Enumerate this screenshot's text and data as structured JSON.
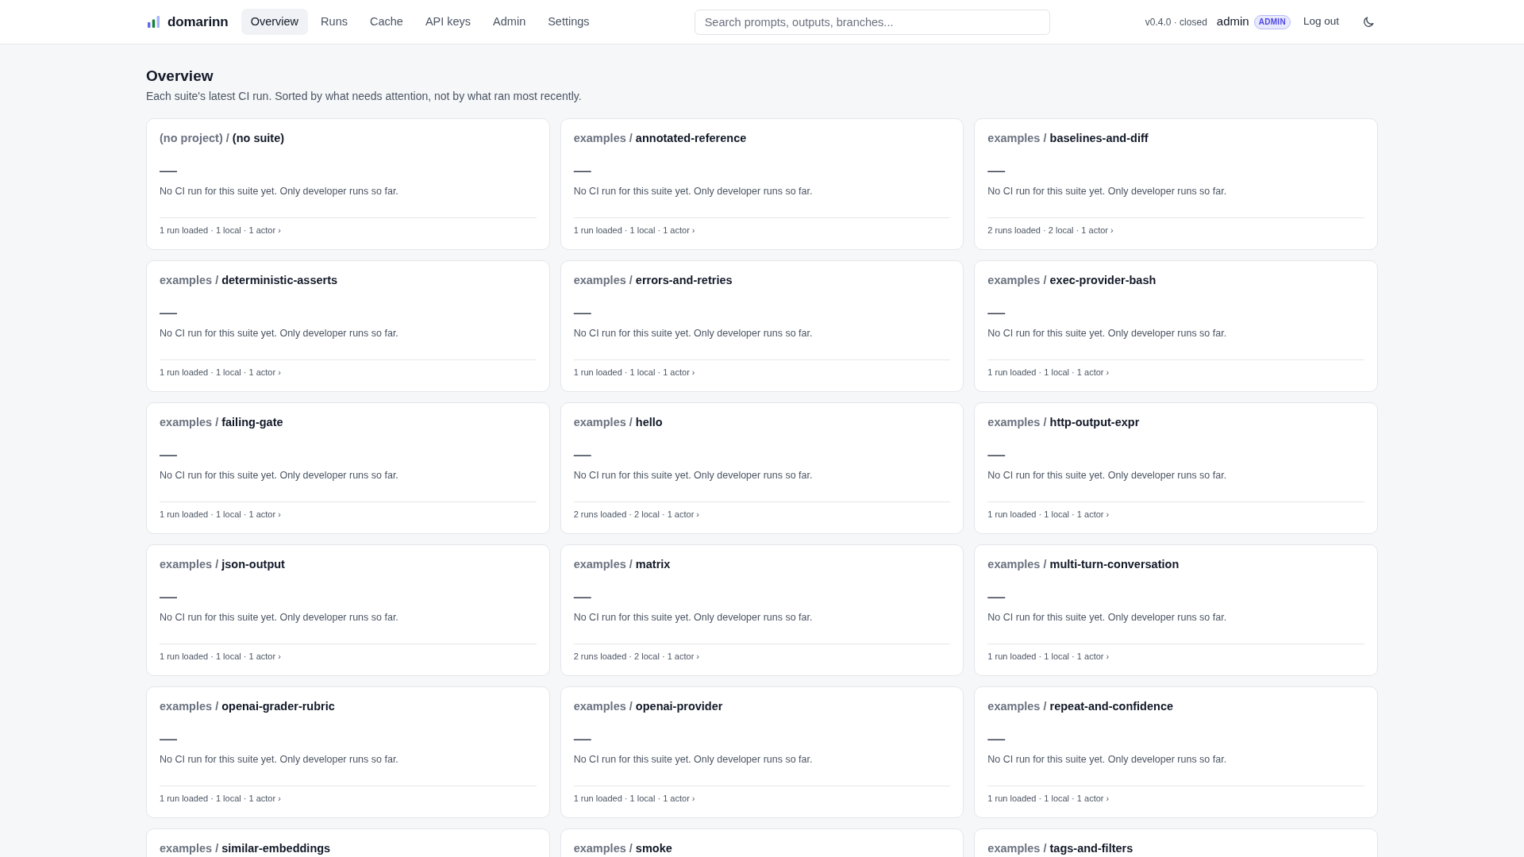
{
  "header": {
    "brand": "domarinn",
    "nav": [
      {
        "label": "Overview",
        "selected": true
      },
      {
        "label": "Runs",
        "selected": false
      },
      {
        "label": "Cache",
        "selected": false
      },
      {
        "label": "API keys",
        "selected": false
      },
      {
        "label": "Admin",
        "selected": false
      },
      {
        "label": "Settings",
        "selected": false
      }
    ],
    "search": {
      "placeholder": "Search prompts, outputs, branches..."
    },
    "version": "v0.4.0 · closed",
    "user": "admin",
    "role_badge": "ADMIN",
    "logout": "Log out"
  },
  "page": {
    "title": "Overview",
    "subtitle": "Each suite's latest CI run. Sorted by what needs attention, not by what ran most recently."
  },
  "suites": [
    {
      "project_path": "(no project) /",
      "suite": "(no suite)",
      "status": "—",
      "note": "No CI run for this suite yet. Only developer runs so far.",
      "summary": "1 run loaded · 1 local · 1 actor ›"
    },
    {
      "project_path": "examples /",
      "suite": "annotated-reference",
      "status": "—",
      "note": "No CI run for this suite yet. Only developer runs so far.",
      "summary": "1 run loaded · 1 local · 1 actor ›"
    },
    {
      "project_path": "examples /",
      "suite": "baselines-and-diff",
      "status": "—",
      "note": "No CI run for this suite yet. Only developer runs so far.",
      "summary": "2 runs loaded · 2 local · 1 actor ›"
    },
    {
      "project_path": "examples /",
      "suite": "deterministic-asserts",
      "status": "—",
      "note": "No CI run for this suite yet. Only developer runs so far.",
      "summary": "1 run loaded · 1 local · 1 actor ›"
    },
    {
      "project_path": "examples /",
      "suite": "errors-and-retries",
      "status": "—",
      "note": "No CI run for this suite yet. Only developer runs so far.",
      "summary": "1 run loaded · 1 local · 1 actor ›"
    },
    {
      "project_path": "examples /",
      "suite": "exec-provider-bash",
      "status": "—",
      "note": "No CI run for this suite yet. Only developer runs so far.",
      "summary": "1 run loaded · 1 local · 1 actor ›"
    },
    {
      "project_path": "examples /",
      "suite": "failing-gate",
      "status": "—",
      "note": "No CI run for this suite yet. Only developer runs so far.",
      "summary": "1 run loaded · 1 local · 1 actor ›"
    },
    {
      "project_path": "examples /",
      "suite": "hello",
      "status": "—",
      "note": "No CI run for this suite yet. Only developer runs so far.",
      "summary": "2 runs loaded · 2 local · 1 actor ›"
    },
    {
      "project_path": "examples /",
      "suite": "http-output-expr",
      "status": "—",
      "note": "No CI run for this suite yet. Only developer runs so far.",
      "summary": "1 run loaded · 1 local · 1 actor ›"
    },
    {
      "project_path": "examples /",
      "suite": "json-output",
      "status": "—",
      "note": "No CI run for this suite yet. Only developer runs so far.",
      "summary": "1 run loaded · 1 local · 1 actor ›"
    },
    {
      "project_path": "examples /",
      "suite": "matrix",
      "status": "—",
      "note": "No CI run for this suite yet. Only developer runs so far.",
      "summary": "2 runs loaded · 2 local · 1 actor ›"
    },
    {
      "project_path": "examples /",
      "suite": "multi-turn-conversation",
      "status": "—",
      "note": "No CI run for this suite yet. Only developer runs so far.",
      "summary": "1 run loaded · 1 local · 1 actor ›"
    },
    {
      "project_path": "examples /",
      "suite": "openai-grader-rubric",
      "status": "—",
      "note": "No CI run for this suite yet. Only developer runs so far.",
      "summary": "1 run loaded · 1 local · 1 actor ›"
    },
    {
      "project_path": "examples /",
      "suite": "openai-provider",
      "status": "—",
      "note": "No CI run for this suite yet. Only developer runs so far.",
      "summary": "1 run loaded · 1 local · 1 actor ›"
    },
    {
      "project_path": "examples /",
      "suite": "repeat-and-confidence",
      "status": "—",
      "note": "No CI run for this suite yet. Only developer runs so far.",
      "summary": "1 run loaded · 1 local · 1 actor ›"
    },
    {
      "project_path": "examples /",
      "suite": "similar-embeddings"
    },
    {
      "project_path": "examples /",
      "suite": "smoke"
    },
    {
      "project_path": "examples /",
      "suite": "tags-and-filters"
    }
  ]
}
